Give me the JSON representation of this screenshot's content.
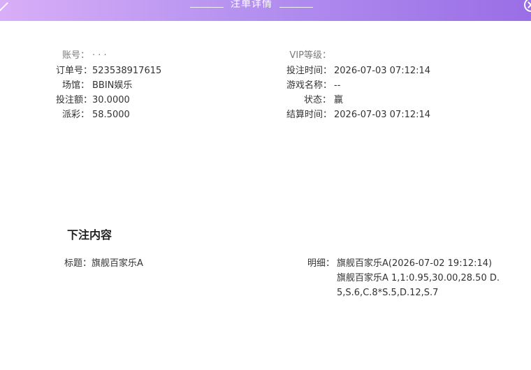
{
  "header": {
    "title": "注单详情"
  },
  "info": {
    "left": [
      {
        "label": "账号：",
        "value": "· · ·"
      },
      {
        "label": "订单号：",
        "value": "523538917615"
      },
      {
        "label": "场馆：",
        "value": "BBIN娱乐"
      },
      {
        "label": "投注额：",
        "value": "30.0000"
      },
      {
        "label": "派彩：",
        "value": "58.5000"
      }
    ],
    "right": [
      {
        "label": "VIP等级：",
        "value": ""
      },
      {
        "label": "投注时间：",
        "value": "2026-07-03 07:12:14"
      },
      {
        "label": "游戏名称：",
        "value": "--"
      },
      {
        "label": "状态：",
        "value": "赢"
      },
      {
        "label": "结算时间：",
        "value": "2026-07-03 07:12:14"
      }
    ]
  },
  "bet_content": {
    "heading": "下注内容",
    "title_label": "标题：",
    "title_value": "旗舰百家乐A",
    "detail_label": "明细：",
    "detail_lines": [
      "旗舰百家乐A(2026-07-02 19:12:14)",
      "旗舰百家乐A 1,1:0.95,30.00,28.50 D.",
      "5,S.6,C.8*S.5,D.12,S.7"
    ]
  }
}
